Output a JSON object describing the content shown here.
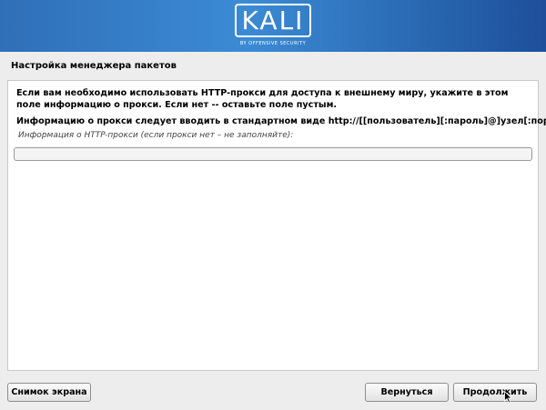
{
  "header": {
    "logo_text": "KALI",
    "logo_subtitle": "BY OFFENSIVE SECURITY",
    "colors": {
      "banner_left": "#2f6fb8",
      "banner_mid": "#3b8bd4",
      "banner_right": "#1d4f9a"
    }
  },
  "page": {
    "title": "Настройка менеджера пакетов"
  },
  "main": {
    "description": "Если вам необходимо использовать HTTP-прокси для доступа к внешнему миру, укажите в этом поле информацию о прокси. Если нет -- оставьте поле пустым.",
    "format_hint": "Информацию о прокси следует вводить в стандартном виде http://[[пользователь][:пароль]@]узел[:порт]/",
    "field_label": "Информация о HTTP-прокси (если прокси нет – не заполняйте):",
    "proxy_value": ""
  },
  "buttons": {
    "screenshot": "Снимок экрана",
    "back": "Вернуться",
    "continue": "Продолжить"
  },
  "icons": {
    "cursor": "mouse-pointer-icon"
  }
}
